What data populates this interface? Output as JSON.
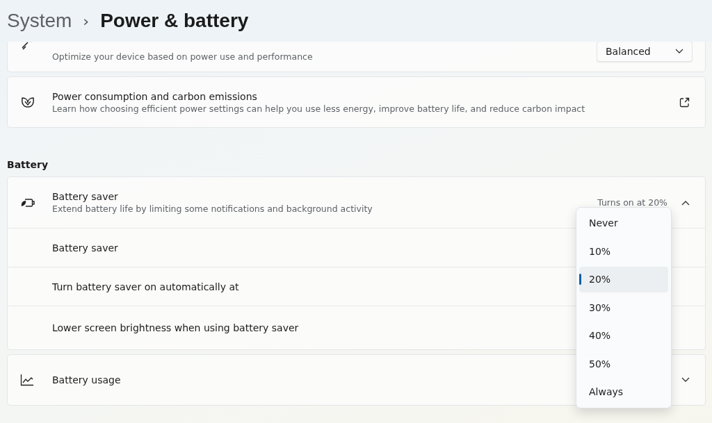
{
  "breadcrumb": {
    "parent": "System",
    "separator": "›",
    "current": "Power & battery"
  },
  "power_mode": {
    "description": "Optimize your device based on power use and performance",
    "value": "Balanced"
  },
  "carbon": {
    "title": "Power consumption and carbon emissions",
    "description": "Learn how choosing efficient power settings can help you use less energy, improve battery life, and reduce carbon impact"
  },
  "section_title": "Battery",
  "battery_saver": {
    "title": "Battery saver",
    "description": "Extend battery life by limiting some notifications and background activity",
    "status": "Turns on at 20%",
    "expanded": true,
    "rows": [
      {
        "label": "Battery saver"
      },
      {
        "label": "Turn battery saver on automatically at"
      },
      {
        "label": "Lower screen brightness when using battery saver"
      }
    ]
  },
  "battery_usage": {
    "title": "Battery usage",
    "expanded": false
  },
  "threshold_menu": [
    {
      "label": "Never",
      "selected": false
    },
    {
      "label": "10%",
      "selected": false
    },
    {
      "label": "20%",
      "selected": true
    },
    {
      "label": "30%",
      "selected": false
    },
    {
      "label": "40%",
      "selected": false
    },
    {
      "label": "50%",
      "selected": false
    },
    {
      "label": "Always",
      "selected": false
    }
  ]
}
